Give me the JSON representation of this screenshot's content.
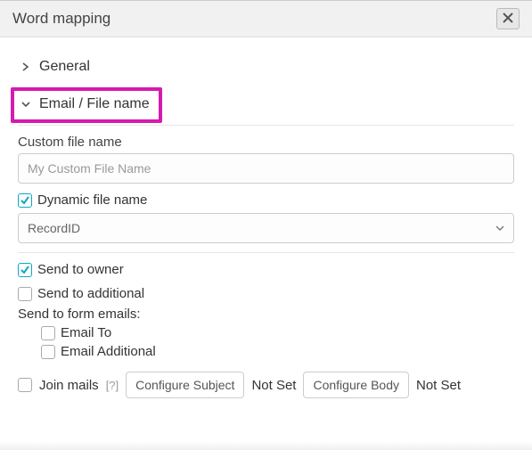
{
  "dialog": {
    "title": "Word mapping"
  },
  "sections": {
    "general": {
      "label": "General"
    },
    "email_file": {
      "label": "Email / File name"
    }
  },
  "custom_file": {
    "label": "Custom file name",
    "placeholder": "My Custom File Name"
  },
  "dynamic_file": {
    "label": "Dynamic file name",
    "selected": "RecordID"
  },
  "send": {
    "owner": "Send to owner",
    "additional": "Send to additional",
    "form_heading": "Send to form emails:",
    "email_to": "Email To",
    "email_additional": "Email Additional"
  },
  "join": {
    "label": "Join mails",
    "help": "[?]",
    "configure_subject": "Configure Subject",
    "subject_status": "Not Set",
    "configure_body": "Configure Body",
    "body_status": "Not Set"
  }
}
